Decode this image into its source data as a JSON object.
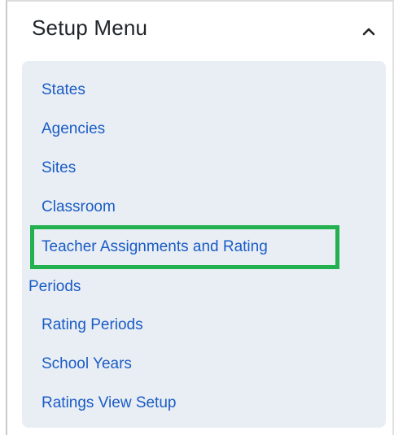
{
  "panel": {
    "title": "Setup Menu",
    "collapse_icon": "chevron-up-icon"
  },
  "menu": {
    "items": [
      {
        "label": "States"
      },
      {
        "label": "Agencies"
      },
      {
        "label": "Sites"
      },
      {
        "label": "Classroom"
      },
      {
        "label": "Teacher Assignments and Rating",
        "continuation": "Periods",
        "highlighted": true
      },
      {
        "label": "Rating Periods"
      },
      {
        "label": "School Years"
      },
      {
        "label": "Ratings View Setup"
      }
    ]
  },
  "colors": {
    "link": "#1a5cc4",
    "menu_background": "#e9eef5",
    "highlight": "#23b04e",
    "title_text": "#212529"
  }
}
